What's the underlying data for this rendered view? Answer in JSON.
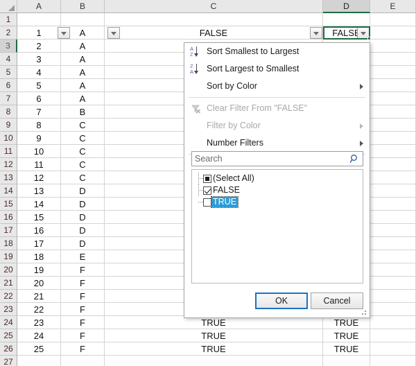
{
  "grid": {
    "columns": [
      {
        "label": "A",
        "active": false
      },
      {
        "label": "B",
        "active": false
      },
      {
        "label": "C",
        "active": false
      },
      {
        "label": "D",
        "active": true
      },
      {
        "label": "E",
        "active": false
      }
    ],
    "rows": [
      {
        "num": "1",
        "active": false,
        "A": "",
        "B": "",
        "C": "",
        "D": ""
      },
      {
        "num": "2",
        "active": false,
        "A": "1",
        "B": "A",
        "C": "FALSE",
        "D": "FALSE"
      },
      {
        "num": "3",
        "active": true,
        "A": "2",
        "B": "A",
        "C": "",
        "D": ""
      },
      {
        "num": "4",
        "active": false,
        "A": "3",
        "B": "A",
        "C": "",
        "D": ""
      },
      {
        "num": "5",
        "active": false,
        "A": "4",
        "B": "A",
        "C": "",
        "D": ""
      },
      {
        "num": "6",
        "active": false,
        "A": "5",
        "B": "A",
        "C": "",
        "D": ""
      },
      {
        "num": "7",
        "active": false,
        "A": "6",
        "B": "A",
        "C": "",
        "D": ""
      },
      {
        "num": "8",
        "active": false,
        "A": "7",
        "B": "B",
        "C": "",
        "D": ""
      },
      {
        "num": "9",
        "active": false,
        "A": "8",
        "B": "C",
        "C": "",
        "D": ""
      },
      {
        "num": "10",
        "active": false,
        "A": "9",
        "B": "C",
        "C": "",
        "D": ""
      },
      {
        "num": "11",
        "active": false,
        "A": "10",
        "B": "C",
        "C": "",
        "D": ""
      },
      {
        "num": "12",
        "active": false,
        "A": "11",
        "B": "C",
        "C": "",
        "D": ""
      },
      {
        "num": "13",
        "active": false,
        "A": "12",
        "B": "C",
        "C": "",
        "D": ""
      },
      {
        "num": "14",
        "active": false,
        "A": "13",
        "B": "D",
        "C": "",
        "D": ""
      },
      {
        "num": "15",
        "active": false,
        "A": "14",
        "B": "D",
        "C": "",
        "D": ""
      },
      {
        "num": "16",
        "active": false,
        "A": "15",
        "B": "D",
        "C": "",
        "D": ""
      },
      {
        "num": "17",
        "active": false,
        "A": "16",
        "B": "D",
        "C": "",
        "D": ""
      },
      {
        "num": "18",
        "active": false,
        "A": "17",
        "B": "D",
        "C": "",
        "D": ""
      },
      {
        "num": "19",
        "active": false,
        "A": "18",
        "B": "E",
        "C": "",
        "D": ""
      },
      {
        "num": "20",
        "active": false,
        "A": "19",
        "B": "F",
        "C": "",
        "D": ""
      },
      {
        "num": "21",
        "active": false,
        "A": "20",
        "B": "F",
        "C": "",
        "D": ""
      },
      {
        "num": "22",
        "active": false,
        "A": "21",
        "B": "F",
        "C": "",
        "D": ""
      },
      {
        "num": "23",
        "active": false,
        "A": "22",
        "B": "F",
        "C": "",
        "D": ""
      },
      {
        "num": "24",
        "active": false,
        "A": "23",
        "B": "F",
        "C": "TRUE",
        "D": "TRUE"
      },
      {
        "num": "25",
        "active": false,
        "A": "24",
        "B": "F",
        "C": "TRUE",
        "D": "TRUE"
      },
      {
        "num": "26",
        "active": false,
        "A": "25",
        "B": "F",
        "C": "TRUE",
        "D": "TRUE"
      },
      {
        "num": "27",
        "active": false,
        "A": "",
        "B": "",
        "C": "",
        "D": ""
      }
    ],
    "active_cell": "D2",
    "filter_buttons": [
      "A",
      "B",
      "C",
      "D"
    ]
  },
  "filter_menu": {
    "items": [
      {
        "label": "Sort Smallest to Largest",
        "icon": "sort-ascending-icon",
        "disabled": false,
        "submenu": false
      },
      {
        "label": "Sort Largest to Smallest",
        "icon": "sort-descending-icon",
        "disabled": false,
        "submenu": false
      },
      {
        "label": "Sort by Color",
        "icon": "none",
        "disabled": false,
        "submenu": true
      },
      {
        "label": "Clear Filter From \"FALSE\"",
        "icon": "clear-filter-icon",
        "disabled": true,
        "submenu": false
      },
      {
        "label": "Filter by Color",
        "icon": "none",
        "disabled": true,
        "submenu": true
      },
      {
        "label": "Number Filters",
        "icon": "none",
        "disabled": false,
        "submenu": true
      }
    ],
    "search": {
      "placeholder": "Search",
      "value": "",
      "icon": "search-icon"
    },
    "checklist": [
      {
        "label": "(Select All)",
        "state": "partial",
        "selected": false
      },
      {
        "label": "FALSE",
        "state": "checked",
        "selected": false
      },
      {
        "label": "TRUE",
        "state": "unchecked",
        "selected": true
      }
    ],
    "ok_label": "OK",
    "cancel_label": "Cancel"
  },
  "colors": {
    "accent_green": "#1e6b41",
    "focus_blue": "#1a72c4",
    "selection_blue": "#2e9bd6",
    "header_gray": "#e8e8e8"
  }
}
